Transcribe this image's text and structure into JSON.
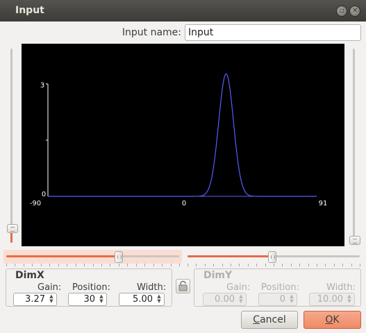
{
  "window": {
    "title": "Input",
    "buttons": {
      "restore_icon": "restore-icon",
      "close_icon": "close-icon"
    }
  },
  "input_name": {
    "label": "Input name:",
    "value": "Input"
  },
  "plot": {
    "chart_data": {
      "type": "line",
      "x_ticks": [
        "-90",
        "0",
        "91"
      ],
      "y_ticks": [
        "3",
        "0"
      ],
      "xlim": [
        -90,
        91
      ],
      "ylim": [
        0,
        3
      ],
      "grid": false,
      "series": [
        {
          "color": "#5b5bff",
          "function": "gaussian",
          "gain": 3.27,
          "position": 30,
          "width": 5.0
        }
      ]
    }
  },
  "sliders": {
    "left_vertical_fraction": 0.0,
    "right_vertical_fraction": 0.0,
    "dimx_horizontal_fraction": 0.65,
    "dimy_horizontal_fraction": 0.49
  },
  "dimx": {
    "title": "DimX",
    "gain_label": "Gain:",
    "gain_value": "3.27",
    "position_label": "Position:",
    "position_value": "30",
    "width_label": "Width:",
    "width_value": "5.00"
  },
  "dimy": {
    "title": "DimY",
    "gain_label": "Gain:",
    "gain_value": "0.00",
    "position_label": "Position:",
    "position_value": "0",
    "width_label": "Width:",
    "width_value": "10.00"
  },
  "lock_icon": "lock-icon",
  "buttons": {
    "cancel_accel": "C",
    "cancel_rest": "ancel",
    "ok_accel": "O",
    "ok_rest": "K"
  },
  "colors": {
    "accent": "#e86a43",
    "plot_bg": "#000000",
    "curve": "#5b5bff"
  }
}
